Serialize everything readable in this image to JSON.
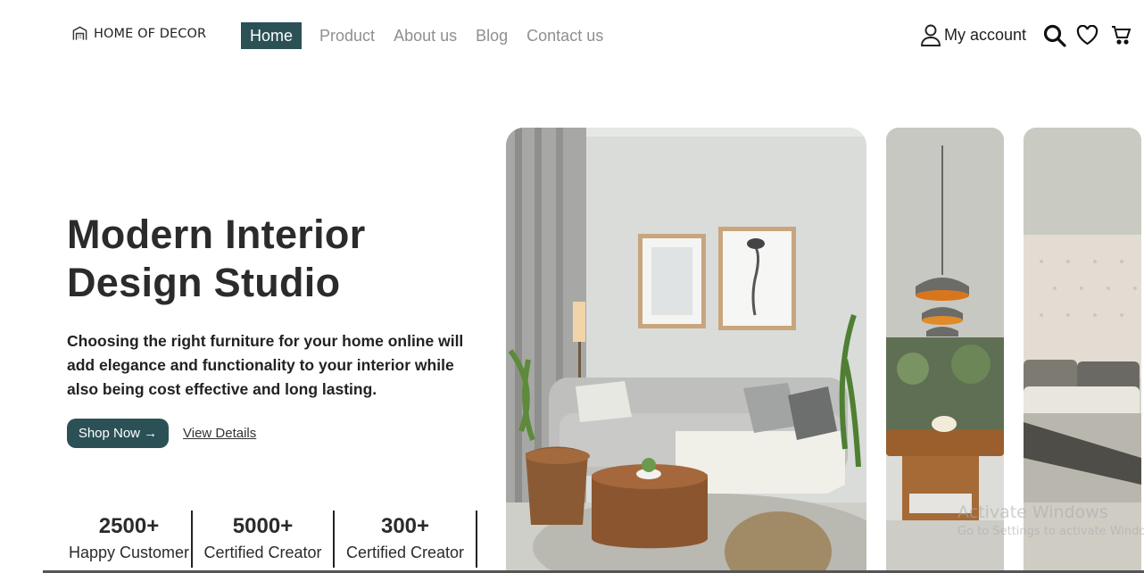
{
  "header": {
    "brand": "HOME OF DECOR",
    "nav": [
      {
        "label": "Home",
        "active": true
      },
      {
        "label": "Product",
        "active": false
      },
      {
        "label": "About us",
        "active": false
      },
      {
        "label": "Blog",
        "active": false
      },
      {
        "label": "Contact us",
        "active": false
      }
    ],
    "account_label": "My account",
    "icons": [
      "user-icon",
      "search-icon",
      "heart-icon",
      "cart-icon"
    ]
  },
  "hero": {
    "title_line1": "Modern Interior",
    "title_line2": "Design Studio",
    "description": "Choosing the right furniture for your home online will add elegance and functionality to your interior while also being cost effective and long lasting.",
    "shop_button": "Shop Now →",
    "view_link": "View Details"
  },
  "stats": [
    {
      "value": "2500+",
      "label": "Happy Customer"
    },
    {
      "value": "5000+",
      "label": "Certified Creator"
    },
    {
      "value": "300+",
      "label": "Certified Creator"
    }
  ],
  "watermark": {
    "title": "Activate Windows",
    "subtitle": "Go to Settings to activate Windows."
  },
  "colors": {
    "accent": "#2b5156",
    "text": "#2b2b2b",
    "nav_inactive": "#8f8f8f"
  }
}
